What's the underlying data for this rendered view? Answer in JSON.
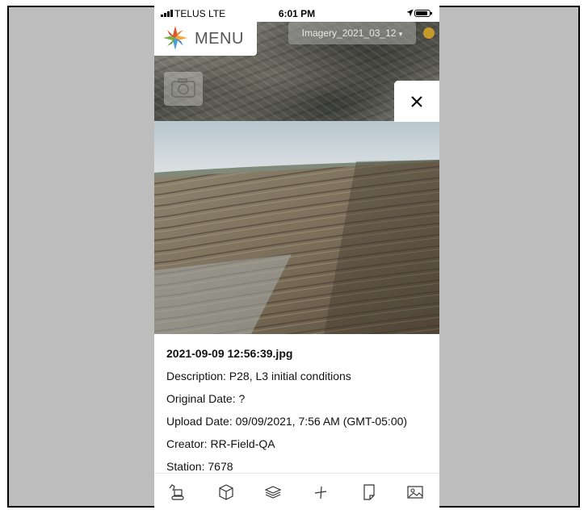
{
  "status_bar": {
    "carrier": "TELUS  LTE",
    "time": "6:01 PM"
  },
  "menu": {
    "label": "MENU",
    "logo_icon": "compass-star-logo"
  },
  "imagery": {
    "selected": "Imagery_2021_03_12"
  },
  "map_controls": {
    "camera_icon": "camera-icon",
    "info_icon": "info-dot-icon",
    "close_icon": "close-icon"
  },
  "photo_details": {
    "filename": "2021-09-09 12:56:39.jpg",
    "description": "Description: P28, L3 initial conditions",
    "original_date": "Original Date: ?",
    "upload_date": "Upload Date: 09/09/2021, 7:56 AM (GMT-05:00)",
    "creator": "Creator: RR-Field-QA",
    "station": "Station: 7678"
  },
  "toolbar": {
    "items": [
      {
        "icon": "excavator-icon"
      },
      {
        "icon": "cube-icon"
      },
      {
        "icon": "layers-icon"
      },
      {
        "icon": "measure-icon"
      },
      {
        "icon": "note-icon"
      },
      {
        "icon": "image-icon"
      }
    ]
  },
  "colors": {
    "frame_background": "#bdbdbd",
    "info_dot": "#c69a2a",
    "sky": "#c9d3d8",
    "soil": "#8a7a62"
  }
}
